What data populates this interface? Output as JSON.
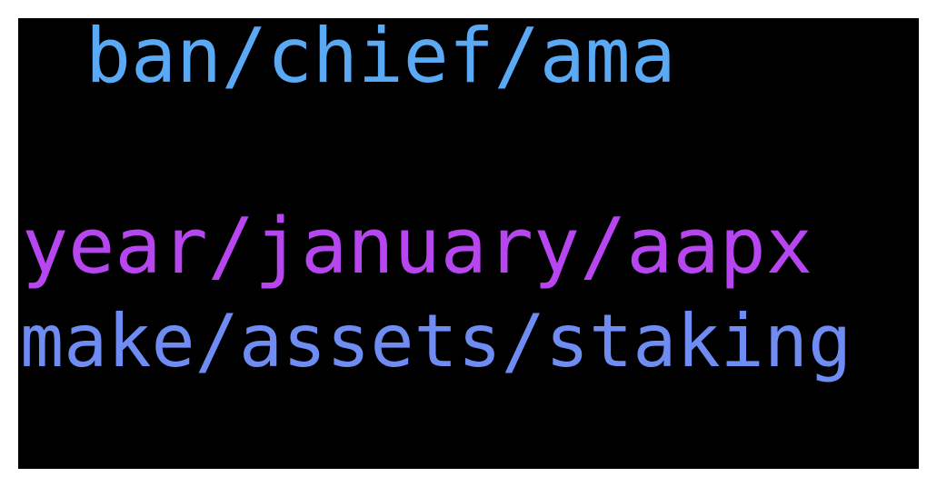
{
  "wordcloud": {
    "words": [
      {
        "text": "ban/chief/ama",
        "color": "#5aa9f5"
      },
      {
        "text": "year/january/aapx",
        "color": "#b846f0"
      },
      {
        "text": "make/assets/staking",
        "color": "#6f8cf2"
      }
    ]
  }
}
